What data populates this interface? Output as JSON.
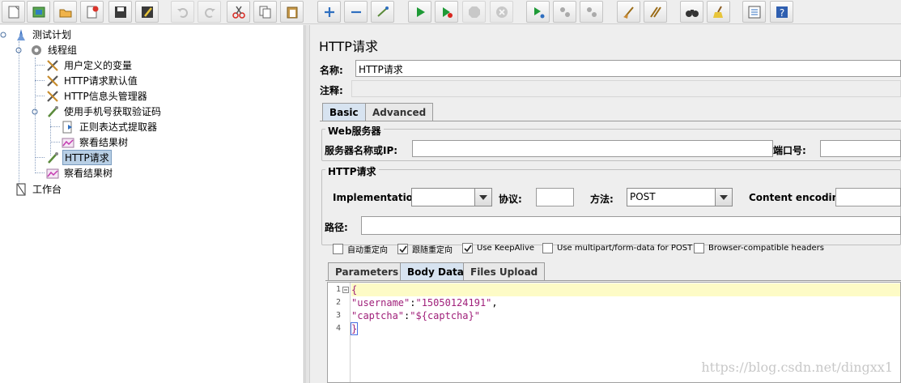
{
  "toolbar": {
    "buttons": [
      {
        "icon": "new-file-icon"
      },
      {
        "icon": "templates-icon"
      },
      {
        "icon": "open-folder-icon"
      },
      {
        "icon": "close-file-icon"
      },
      {
        "icon": "save-icon"
      },
      {
        "icon": "save-as-icon"
      },
      {
        "icon": "undo-icon",
        "disabled": true
      },
      {
        "icon": "redo-icon",
        "disabled": true
      },
      {
        "icon": "cut-icon"
      },
      {
        "icon": "copy-icon"
      },
      {
        "icon": "paste-icon"
      },
      {
        "icon": "expand-icon"
      },
      {
        "icon": "collapse-icon"
      },
      {
        "icon": "toggle-icon"
      },
      {
        "icon": "run-icon"
      },
      {
        "icon": "run-no-pause-icon"
      },
      {
        "icon": "stop-icon",
        "disabled": true
      },
      {
        "icon": "shutdown-icon",
        "disabled": true
      },
      {
        "icon": "remote-start-icon"
      },
      {
        "icon": "remote-stop-icon"
      },
      {
        "icon": "remote-shutdown-icon"
      },
      {
        "icon": "clear-icon"
      },
      {
        "icon": "clear-all-icon"
      },
      {
        "icon": "search-binoculars-icon"
      },
      {
        "icon": "reset-search-broom-icon"
      },
      {
        "icon": "function-helper-icon"
      },
      {
        "icon": "help-icon"
      }
    ]
  },
  "tree": {
    "nodes": [
      {
        "label": "测试计划",
        "icon": "test-plan-icon"
      },
      {
        "label": "线程组",
        "icon": "thread-group-icon"
      },
      {
        "label": "用户定义的变量",
        "icon": "config-wrench-icon"
      },
      {
        "label": "HTTP请求默认值",
        "icon": "config-wrench-icon"
      },
      {
        "label": "HTTP信息头管理器",
        "icon": "config-wrench-icon"
      },
      {
        "label": "使用手机号获取验证码",
        "icon": "sampler-pipette-icon"
      },
      {
        "label": "正则表达式提取器",
        "icon": "post-processor-icon"
      },
      {
        "label": "察看结果树",
        "icon": "listener-chart-icon"
      },
      {
        "label": "HTTP请求",
        "icon": "sampler-pipette-icon",
        "selected": true
      },
      {
        "label": "察看结果树",
        "icon": "listener-chart-icon"
      },
      {
        "label": "工作台",
        "icon": "workbench-icon"
      }
    ]
  },
  "panel": {
    "title": "HTTP请求",
    "name_label": "名称:",
    "name_value": "HTTP请求",
    "comment_label": "注释:",
    "comment_value": "",
    "tabs": [
      {
        "label": "Basic",
        "active": true
      },
      {
        "label": "Advanced",
        "active": false
      }
    ],
    "web_server": {
      "legend": "Web服务器",
      "server_label": "服务器名称或IP:",
      "server_value": "",
      "port_label": "端口号:",
      "port_value": ""
    },
    "http_request": {
      "legend": "HTTP请求",
      "implementation_label": "Implementation:",
      "implementation_value": "",
      "protocol_label": "协议:",
      "protocol_value": "",
      "method_label": "方法:",
      "method_value": "POST",
      "encoding_label": "Content encoding:",
      "encoding_value": "",
      "path_label": "路径:",
      "path_value": ""
    },
    "options": [
      {
        "label": "自动重定向",
        "checked": false
      },
      {
        "label": "跟随重定向",
        "checked": true
      },
      {
        "label": "Use KeepAlive",
        "checked": true
      },
      {
        "label": "Use multipart/form-data for POST",
        "checked": false
      },
      {
        "label": "Browser-compatible headers",
        "checked": false
      }
    ],
    "subtabs": [
      {
        "label": "Parameters",
        "active": false
      },
      {
        "label": "Body Data",
        "active": true
      },
      {
        "label": "Files Upload",
        "active": false
      }
    ],
    "body_lines": [
      {
        "num": "1",
        "text": "{"
      },
      {
        "num": "2",
        "key": "\"username\"",
        "sep": ":",
        "val": "\"15050124191\"",
        "tail": ","
      },
      {
        "num": "3",
        "key": "\"captcha\"",
        "sep": ":",
        "val": "\"${captcha}\"",
        "tail": ""
      },
      {
        "num": "4",
        "text": "}"
      }
    ]
  },
  "watermark": "https://blog.csdn.net/dingxx1",
  "colors": {
    "selection": "#b8cfe5",
    "active_tab": "#d7e3f0",
    "line_highlight": "#fdfbc6",
    "json_string": "#a0207a"
  }
}
